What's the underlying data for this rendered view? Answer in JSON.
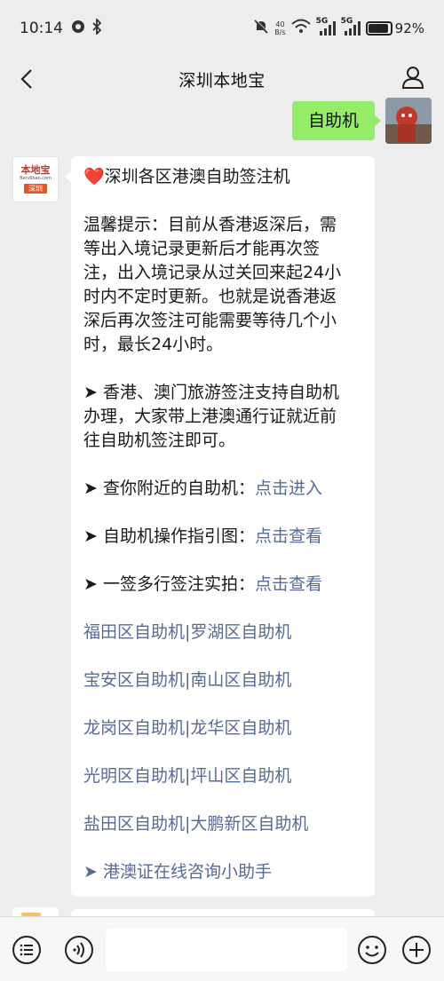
{
  "status_bar": {
    "time": "10:14",
    "net_speed_value": "40",
    "net_speed_unit": "B/s",
    "signal1_label": "5G",
    "signal2_label": "5G",
    "battery_percent": "92%",
    "battery_level": 0.92
  },
  "header": {
    "title": "深圳本地宝"
  },
  "sent_message": {
    "text": "自助机"
  },
  "bot": {
    "avatar_logo": "本地宝",
    "avatar_sub": "Bendibao.com",
    "avatar_city": "深圳"
  },
  "reply": {
    "heading_icon": "❤️",
    "heading": "深圳各区港澳自助签注机",
    "notice_lines": [
      "温馨提示：目前从香港返深后，需",
      "等出入境记录更新后才能再次签",
      "注，出入境记录从过关回来起24小",
      "时内不定时更新。也就是说香港返",
      "深后再次签注可能需要等待几个小",
      "时，最长24小时。"
    ],
    "travel_lines": [
      "➤ 香港、澳门旅游签注支持自助机",
      "办理，大家带上港澳通行证就近前",
      "往自助机签注即可。"
    ],
    "nearby_label": "➤ 查你附近的自助机：",
    "nearby_link": "点击进入",
    "guide_label": "➤ 自助机操作指引图：",
    "guide_link": "点击查看",
    "multi_label": "➤ 一签多行签注实拍：",
    "multi_link": "点击查看",
    "district_links": [
      "福田区自助机|罗湖区自助机",
      "宝安区自助机|南山区自助机",
      "龙岗区自助机|龙华区自助机",
      "光明区自助机|坪山区自助机",
      "盐田区自助机|大鹏新区自助机"
    ],
    "assistant_link": "➤ 港澳证在线咨询小助手"
  },
  "input_bar": {
    "text_value": ""
  },
  "icons": {
    "back": "chevron-left-icon",
    "profile": "person-icon",
    "voice": "voice-icon",
    "menu": "menu-list-icon",
    "emoji": "emoji-icon",
    "more": "plus-circle-icon"
  }
}
